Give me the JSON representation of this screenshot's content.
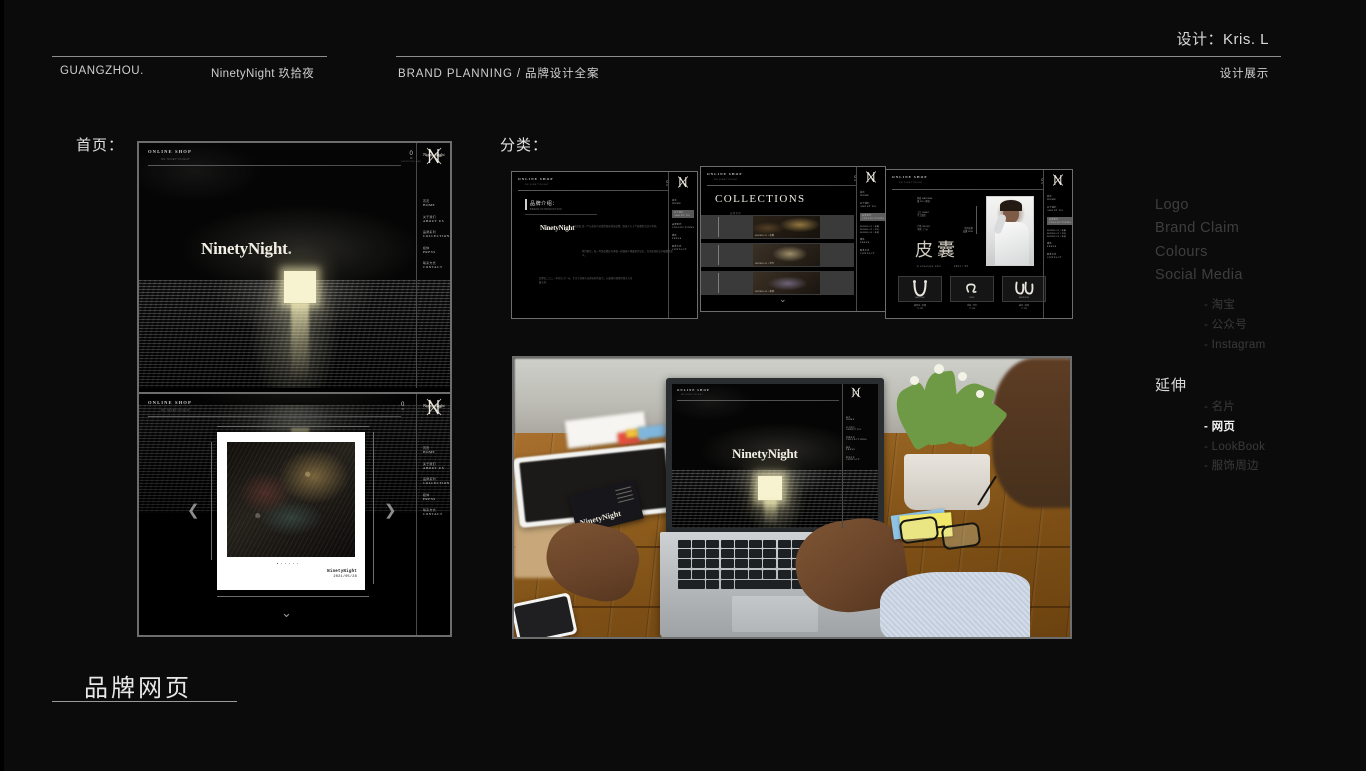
{
  "header": {
    "designer_credit": "设计：Kris. L",
    "city": "GUANGZHOU.",
    "brand": "NinetyNight 玖拾夜",
    "planning_en": "BRAND PLANNING",
    "planning_slash": "/",
    "planning_cn": "品牌设计全案",
    "showcase": "设计展示"
  },
  "sections": {
    "home_label": "首页：",
    "category_label": "分类：",
    "footer_title": "品牌网页"
  },
  "right_nav": {
    "top_items": [
      "Logo",
      "Brand Claim",
      "Colours",
      "Social Media"
    ],
    "social_subs": [
      "- 淘宝",
      "- 公众号",
      "- Instagram"
    ],
    "extension_heading": "延伸",
    "extension_subs": [
      {
        "label": "- 名片",
        "active": false
      },
      {
        "label": "- 网页",
        "active": true
      },
      {
        "label": "- LookBook",
        "active": false
      },
      {
        "label": "- 服饰周边",
        "active": false
      }
    ]
  },
  "site": {
    "shop_label": "ONLINE SHOP",
    "shop_sub": "NN NINETYNIGHT",
    "cart_count": "0",
    "cart_price": "¥0",
    "cart_label": "SHOPPING BAG",
    "logo_name": "ninetynight-monogram",
    "nav": [
      {
        "cn": "首页",
        "en": "HOME"
      },
      {
        "cn": "关于我们",
        "en": "ABOUT US"
      },
      {
        "cn": "品牌系列",
        "en": "COLLECTIONS"
      },
      {
        "cn": "媒体",
        "en": "PRESS"
      },
      {
        "cn": "联系方式",
        "en": "CONTACT"
      }
    ],
    "wordmark": "NinetyNight",
    "wordmark_dot": "."
  },
  "carousel": {
    "caption_title": "NinetyNight",
    "caption_date": "2021/05/28",
    "prev_icon": "chevron-left",
    "next_icon": "chevron-right",
    "scroll_icon": "chevron-down",
    "dot_count": 6,
    "active_dot": 0
  },
  "panel_about": {
    "title": "品牌介绍：",
    "subtitle": "BRAND INTRODUCTION",
    "brandmark": "NinetyNight",
    "para1": "玖拾夜 是一个以夜色为灵感的原创首饰品牌，取意于九十个夜晚的沉淀与等待。",
    "para2": "我们相信，每一件饰品都应当承载一段独属于佩戴者的记忆，在光影流转之间被重新定义。",
    "para3": "品牌自二〇二一年创立于广州，专注于金属与天然石材的结合，以极简的轮廓呈现东方含蓄之美。"
  },
  "panel_collections": {
    "title": "COLLECTIONS",
    "subtitle": "品牌系列",
    "rows": [
      {
        "caption": "SERIES 01 / 皮囊"
      },
      {
        "caption": "SERIES 02 / 浮光"
      },
      {
        "caption": "SERIES 03 / 夜渡"
      }
    ],
    "scroll_icon": "chevron-down"
  },
  "panel_product": {
    "title": "皮囊",
    "subtitle": "A envelope skin",
    "date": "2021 / 05",
    "side_label_cn": "系列名称",
    "side_label_en": "皮囊 SKIN",
    "specs": [
      {
        "cn": "材质 MATERIAL",
        "en": "银 925 / 黄铜"
      },
      {
        "cn": "工艺 CRAFT",
        "en": "手工锻造"
      },
      {
        "cn": "产地 ORIGIN",
        "en": "中国 · 广州"
      }
    ],
    "cards": [
      {
        "icon": "horseshoe-earring",
        "label": "EAR CUFF",
        "cn": "耳骨夹 / 皮囊",
        "price": "￥ 289"
      },
      {
        "icon": "curl-ring",
        "label": "RING",
        "cn": "戒指 / 浮光",
        "price": "￥ 349"
      },
      {
        "icon": "double-hoop",
        "label": "EARRINGS",
        "cn": "耳环 / 夜渡",
        "price": "￥ 399"
      }
    ]
  },
  "photo": {
    "alt_name": "laptop-mockup-on-desk",
    "screen_wordmark": "NinetyNight"
  },
  "colors": {
    "page_bg": "#0b0b0b",
    "frame_border": "#6d6d6d",
    "text_primary": "#e2e2e2",
    "text_dim": "#3e3e3e",
    "accent_glow": "#f7f2cf"
  }
}
